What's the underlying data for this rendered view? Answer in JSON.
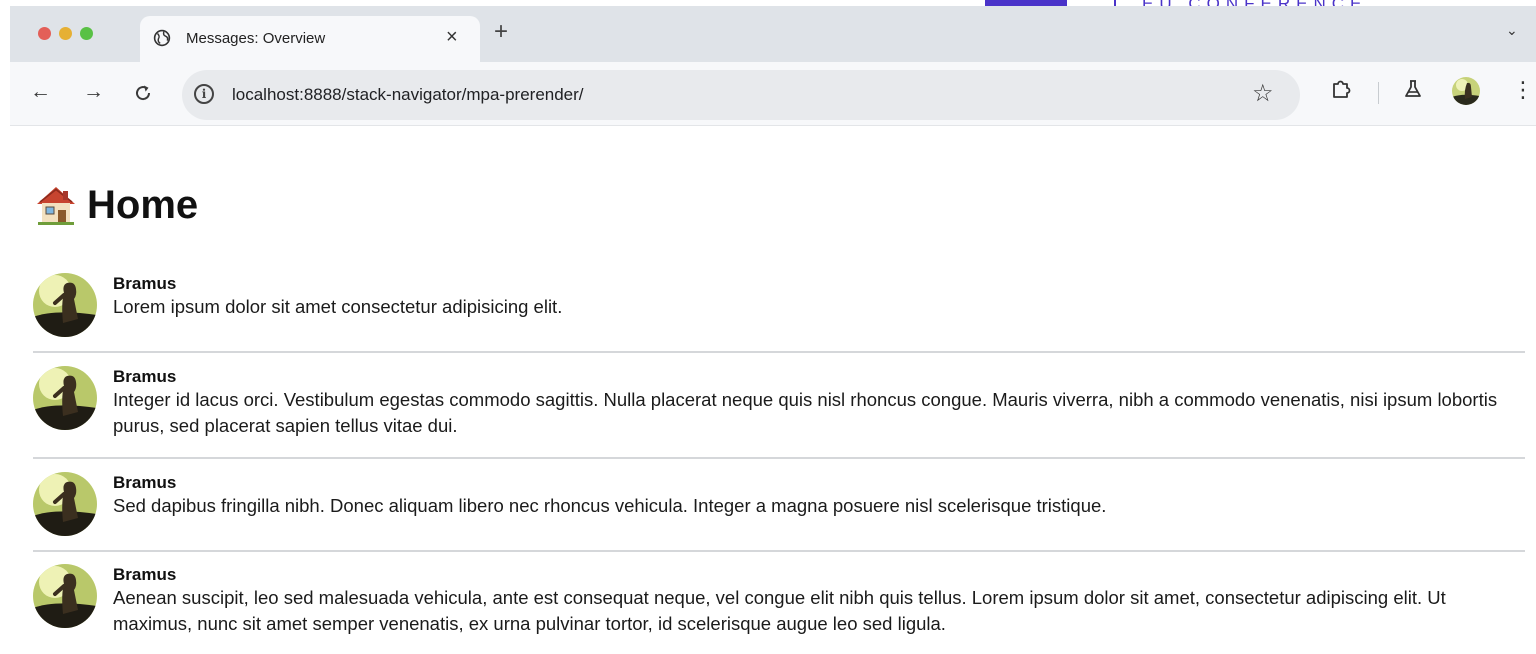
{
  "watermark": {
    "text": "EU CONFERENCE"
  },
  "browser": {
    "tab": {
      "title": "Messages: Overview",
      "favicon": "globe-icon"
    },
    "url": "localhost:8888/stack-navigator/mpa-prerender/",
    "icons": {
      "back": "arrow-left-icon",
      "forward": "arrow-right-icon",
      "reload": "reload-icon",
      "site_info": "info-icon",
      "bookmark": "star-icon",
      "extensions": "puzzle-icon",
      "labs": "flask-icon",
      "menu": "kebab-menu-icon"
    }
  },
  "page": {
    "heading_icon": "house-icon",
    "heading": "Home",
    "messages": [
      {
        "name": "Bramus",
        "text": "Lorem ipsum dolor sit amet consectetur adipisicing elit."
      },
      {
        "name": "Bramus",
        "text": "Integer id lacus orci. Vestibulum egestas commodo sagittis. Nulla placerat neque quis nisl rhoncus congue. Mauris viverra, nibh a commodo venenatis, nisi ipsum lobortis purus, sed placerat sapien tellus vitae dui."
      },
      {
        "name": "Bramus",
        "text": "Sed dapibus fringilla nibh. Donec aliquam libero nec rhoncus vehicula. Integer a magna posuere nisl scelerisque tristique."
      },
      {
        "name": "Bramus",
        "text": "Aenean suscipit, leo sed malesuada vehicula, ante est consequat neque, vel congue elit nibh quis tellus. Lorem ipsum dolor sit amet, consectetur adipiscing elit. Ut maximus, nunc sit amet semper venenatis, ex urna pulvinar tortor, id scelerisque augue leo sed ligula."
      }
    ]
  }
}
